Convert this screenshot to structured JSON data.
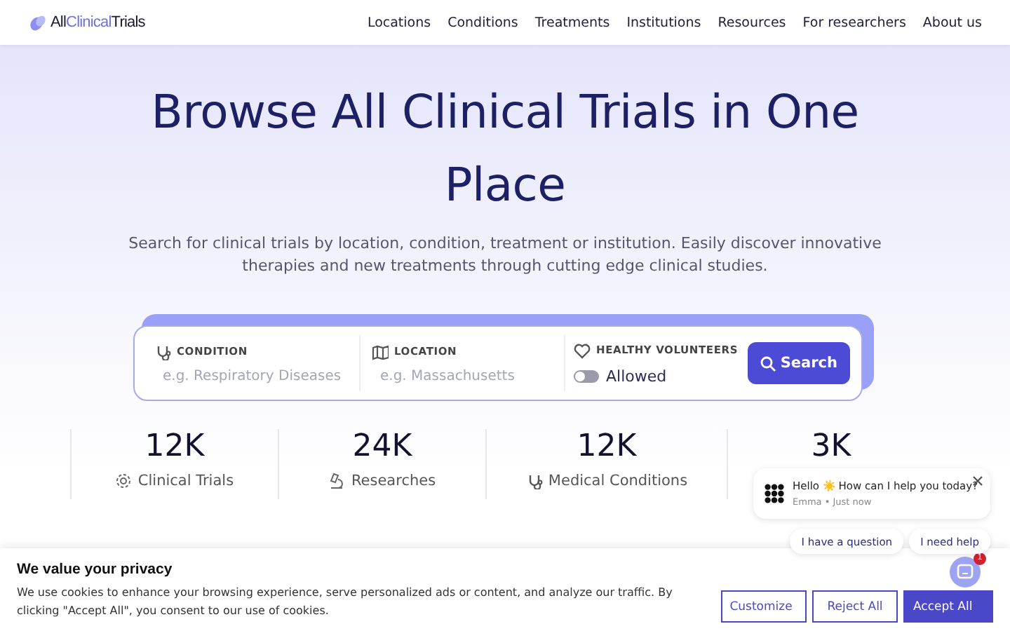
{
  "header": {
    "logo": {
      "prefix": "All",
      "accent": "Clinical",
      "suffix": "Trials"
    },
    "nav": [
      "Locations",
      "Conditions",
      "Treatments",
      "Institutions",
      "Resources",
      "For researchers",
      "About us"
    ]
  },
  "hero": {
    "title": "Browse All Clinical Trials in One Place",
    "subtitle": "Search for clinical trials by location, condition, treatment or institution. Easily discover innovative therapies and new treatments through cutting edge clinical studies."
  },
  "search": {
    "fields": [
      {
        "kind": "text",
        "label": "CONDITION",
        "placeholder": "e.g. Respiratory Diseases"
      },
      {
        "kind": "text",
        "label": "LOCATION",
        "placeholder": "e.g. Massachusetts"
      },
      {
        "kind": "toggle",
        "label": "HEALTHY VOLUNTEERS",
        "value": "Allowed",
        "on": false
      }
    ],
    "button": "Search"
  },
  "stats": [
    {
      "value": "12K",
      "label": "Clinical Trials",
      "kind": "trials"
    },
    {
      "value": "24K",
      "label": "Researches",
      "kind": "research"
    },
    {
      "value": "12K",
      "label": "Medical Conditions",
      "kind": "conditions"
    },
    {
      "value": "3K"
    }
  ],
  "chat": {
    "greeting": "Hello ☀️ How can I help you today?",
    "meta": "Emma • Just now",
    "replies": [
      "I have a question",
      "I need help"
    ],
    "badge": "1"
  },
  "cookie": {
    "title": "We value your privacy",
    "text": "We use cookies to enhance your browsing experience, serve personalized ads or content, and analyze our traffic. By clicking \"Accept All\", you consent to our use of cookies.",
    "buttons": [
      {
        "label": "Customize",
        "kind": "menu"
      },
      {
        "label": "Reject All",
        "kind": "outline"
      },
      {
        "label": "Accept All",
        "kind": "primary"
      }
    ]
  }
}
